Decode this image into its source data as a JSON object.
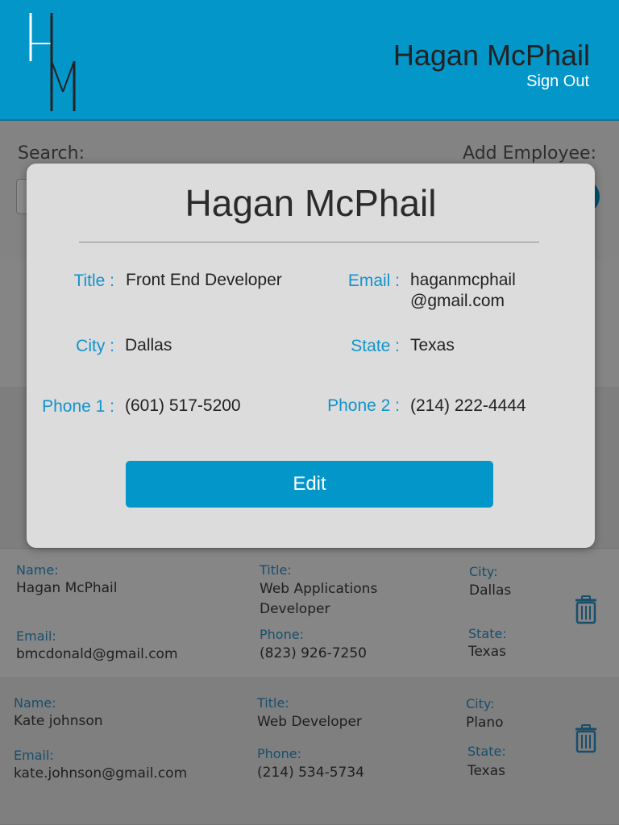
{
  "header": {
    "logo_letters": "HM",
    "user_name": "Hagan McPhail",
    "sign_out": "Sign Out"
  },
  "toolbar": {
    "search_label": "Search:",
    "add_label": "Add Employee:"
  },
  "labels": {
    "name": "Name:",
    "title": "Title:",
    "city": "City:",
    "email": "Email:",
    "phone": "Phone:",
    "state": "State:"
  },
  "employees": [
    {
      "name": "Hagan McPhail",
      "title": "Web Applications Developer",
      "city": "Dallas",
      "email": "bmcdonald@gmail.com",
      "phone": "(823) 926-7250",
      "state": "Texas"
    },
    {
      "name": "Kate johnson",
      "title": "Web Developer",
      "city": "Plano",
      "email": "kate.johnson@gmail.com",
      "phone": "(214) 534-5734",
      "state": "Texas"
    }
  ],
  "modal": {
    "name": "Hagan McPhail",
    "title_label": "Title :",
    "title_value": "Front End Developer",
    "email_label": "Email :",
    "email_value": "haganmcphail @gmail.com",
    "city_label": "City :",
    "city_value": "Dallas",
    "state_label": "State :",
    "state_value": "Texas",
    "phone1_label": "Phone 1 :",
    "phone1_value": "(601) 517-5200",
    "phone2_label": "Phone 2 :",
    "phone2_value": "(214) 222-4444",
    "edit_label": "Edit"
  },
  "colors": {
    "accent": "#0296c9",
    "label_blue": "#1193cd"
  }
}
